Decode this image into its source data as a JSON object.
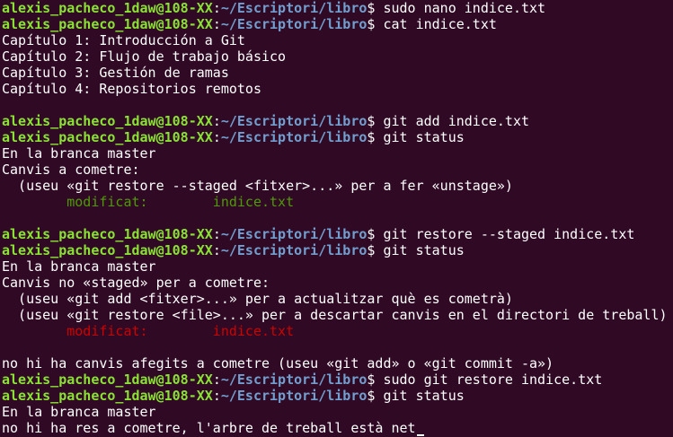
{
  "terminal": {
    "prompt_user": "alexis_pacheco_1daw@108-XX",
    "prompt_path": "~/Escriptori/libro",
    "lines": [
      {
        "type": "prompt",
        "cmd": " sudo nano indice.txt"
      },
      {
        "type": "prompt",
        "cmd": " cat indice.txt"
      },
      {
        "type": "out",
        "text": "Capítulo 1: Introducción a Git"
      },
      {
        "type": "out",
        "text": "Capítulo 2: Flujo de trabajo básico"
      },
      {
        "type": "out",
        "text": "Capítulo 3: Gestión de ramas"
      },
      {
        "type": "out",
        "text": "Capítulo 4: Repositorios remotos"
      },
      {
        "type": "out",
        "text": ""
      },
      {
        "type": "prompt",
        "cmd": " git add indice.txt"
      },
      {
        "type": "prompt",
        "cmd": " git status"
      },
      {
        "type": "out",
        "text": "En la branca master"
      },
      {
        "type": "out",
        "text": "Canvis a cometre:"
      },
      {
        "type": "out",
        "text": "  (useu «git restore --staged <fitxer>...» per a fer «unstage»)"
      },
      {
        "type": "green",
        "text": "\tmodificat:        indice.txt"
      },
      {
        "type": "out",
        "text": ""
      },
      {
        "type": "prompt",
        "cmd": " git restore --staged indice.txt"
      },
      {
        "type": "prompt",
        "cmd": " git status"
      },
      {
        "type": "out",
        "text": "En la branca master"
      },
      {
        "type": "out",
        "text": "Canvis no «staged» per a cometre:"
      },
      {
        "type": "out",
        "text": "  (useu «git add <fitxer>...» per a actualitzar què es cometrà)"
      },
      {
        "type": "out",
        "text": "  (useu «git restore <file>...» per a descartar canvis en el directori de treball)"
      },
      {
        "type": "red",
        "text": "\tmodificat:        indice.txt"
      },
      {
        "type": "out",
        "text": ""
      },
      {
        "type": "out",
        "text": "no hi ha canvis afegits a cometre (useu «git add» o «git commit -a»)"
      },
      {
        "type": "prompt",
        "cmd": " sudo git restore indice.txt"
      },
      {
        "type": "prompt",
        "cmd": " git status"
      },
      {
        "type": "out",
        "text": "En la branca master"
      },
      {
        "type": "out",
        "text": "no hi ha res a cometre, l'arbre de treball està net",
        "cursor": true
      }
    ]
  },
  "colors": {
    "background": "#300a24",
    "prompt_user": "#8ae234",
    "prompt_path": "#729fcf",
    "staged": "#4e9a06",
    "unstaged": "#cc0000",
    "text": "#ffffff"
  }
}
